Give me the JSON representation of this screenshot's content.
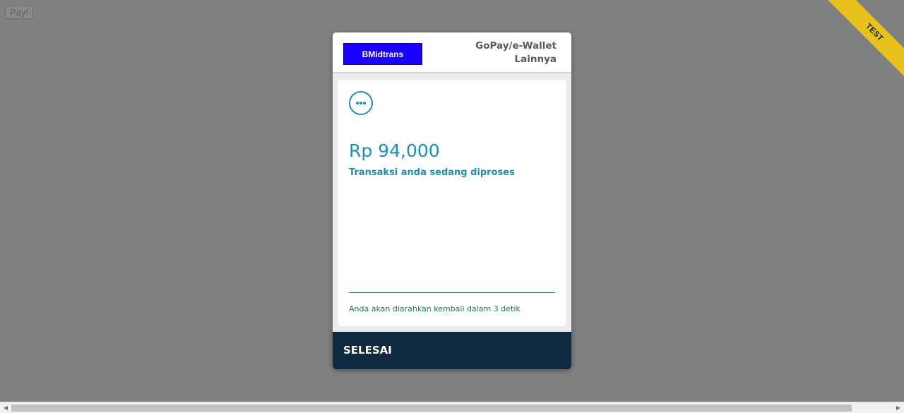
{
  "page": {
    "pay_button_label": "Pay!",
    "ribbon_label": "TEST"
  },
  "header": {
    "brand_name": "BMidtrans",
    "title_line1": "GoPay/e-Wallet",
    "title_line2": "Lainnya"
  },
  "body": {
    "status_icon": "ellipsis-circle-icon",
    "amount": "Rp 94,000",
    "status_text": "Transaksi anda sedang diproses",
    "redirect_text": "Anda akan diarahkan kembali dalam 3 detik"
  },
  "footer": {
    "finish_label": "SELESAI"
  },
  "colors": {
    "backdrop": "#808080",
    "brand": "#1a00ff",
    "accent": "#1b8fb4",
    "success_green": "#1f7a50",
    "footer_navy": "#0f2a40",
    "ribbon_yellow": "#e8c21a"
  },
  "scrollbar": {
    "left_arrow_icon": "chevron-left-icon",
    "right_arrow_icon": "chevron-right-icon"
  }
}
